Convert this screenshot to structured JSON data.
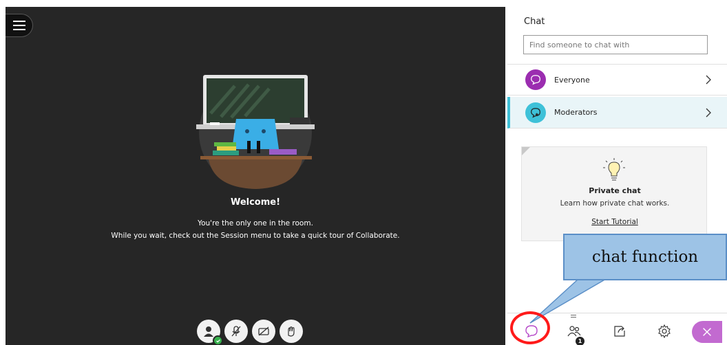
{
  "stage": {
    "welcome_title": "Welcome!",
    "welcome_line1": "You're the only one in the room.",
    "welcome_line2": "While you wait, check out the Session menu to take a quick tour of Collaborate."
  },
  "media_controls": {
    "icons": [
      "user-avatar-icon",
      "microphone-off-icon",
      "camera-off-icon",
      "raise-hand-icon"
    ]
  },
  "chat_panel": {
    "title": "Chat",
    "search_placeholder": "Find someone to chat with",
    "rows": [
      {
        "label": "Everyone",
        "icon": "chat-bubble-icon",
        "color": "#9b2db0"
      },
      {
        "label": "Moderators",
        "icon": "moderator-chat-icon",
        "color": "#3ec1d8",
        "selected": true
      }
    ],
    "tutorial_card": {
      "title": "Private chat",
      "description": "Learn how private chat works.",
      "link": "Start Tutorial"
    }
  },
  "toolbar": {
    "icons": [
      "chat-icon",
      "attendees-icon",
      "share-content-icon",
      "settings-icon",
      "close-panel-icon"
    ],
    "attendee_count": "1",
    "accent_color": "#c26ad0"
  },
  "annotation": {
    "label": "chat function"
  }
}
